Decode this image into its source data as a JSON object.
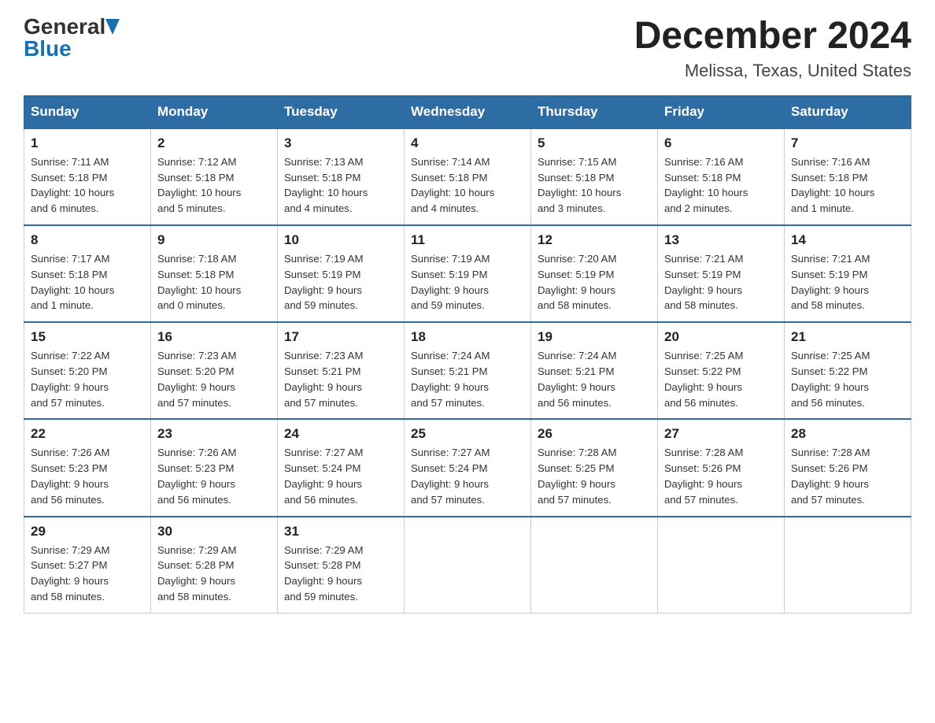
{
  "header": {
    "logo": {
      "general": "General",
      "blue": "Blue"
    },
    "title": "December 2024",
    "subtitle": "Melissa, Texas, United States"
  },
  "days_of_week": [
    "Sunday",
    "Monday",
    "Tuesday",
    "Wednesday",
    "Thursday",
    "Friday",
    "Saturday"
  ],
  "weeks": [
    [
      {
        "day": "1",
        "sunrise": "7:11 AM",
        "sunset": "5:18 PM",
        "daylight": "10 hours and 6 minutes."
      },
      {
        "day": "2",
        "sunrise": "7:12 AM",
        "sunset": "5:18 PM",
        "daylight": "10 hours and 5 minutes."
      },
      {
        "day": "3",
        "sunrise": "7:13 AM",
        "sunset": "5:18 PM",
        "daylight": "10 hours and 4 minutes."
      },
      {
        "day": "4",
        "sunrise": "7:14 AM",
        "sunset": "5:18 PM",
        "daylight": "10 hours and 4 minutes."
      },
      {
        "day": "5",
        "sunrise": "7:15 AM",
        "sunset": "5:18 PM",
        "daylight": "10 hours and 3 minutes."
      },
      {
        "day": "6",
        "sunrise": "7:16 AM",
        "sunset": "5:18 PM",
        "daylight": "10 hours and 2 minutes."
      },
      {
        "day": "7",
        "sunrise": "7:16 AM",
        "sunset": "5:18 PM",
        "daylight": "10 hours and 1 minute."
      }
    ],
    [
      {
        "day": "8",
        "sunrise": "7:17 AM",
        "sunset": "5:18 PM",
        "daylight": "10 hours and 1 minute."
      },
      {
        "day": "9",
        "sunrise": "7:18 AM",
        "sunset": "5:18 PM",
        "daylight": "10 hours and 0 minutes."
      },
      {
        "day": "10",
        "sunrise": "7:19 AM",
        "sunset": "5:19 PM",
        "daylight": "9 hours and 59 minutes."
      },
      {
        "day": "11",
        "sunrise": "7:19 AM",
        "sunset": "5:19 PM",
        "daylight": "9 hours and 59 minutes."
      },
      {
        "day": "12",
        "sunrise": "7:20 AM",
        "sunset": "5:19 PM",
        "daylight": "9 hours and 58 minutes."
      },
      {
        "day": "13",
        "sunrise": "7:21 AM",
        "sunset": "5:19 PM",
        "daylight": "9 hours and 58 minutes."
      },
      {
        "day": "14",
        "sunrise": "7:21 AM",
        "sunset": "5:19 PM",
        "daylight": "9 hours and 58 minutes."
      }
    ],
    [
      {
        "day": "15",
        "sunrise": "7:22 AM",
        "sunset": "5:20 PM",
        "daylight": "9 hours and 57 minutes."
      },
      {
        "day": "16",
        "sunrise": "7:23 AM",
        "sunset": "5:20 PM",
        "daylight": "9 hours and 57 minutes."
      },
      {
        "day": "17",
        "sunrise": "7:23 AM",
        "sunset": "5:21 PM",
        "daylight": "9 hours and 57 minutes."
      },
      {
        "day": "18",
        "sunrise": "7:24 AM",
        "sunset": "5:21 PM",
        "daylight": "9 hours and 57 minutes."
      },
      {
        "day": "19",
        "sunrise": "7:24 AM",
        "sunset": "5:21 PM",
        "daylight": "9 hours and 56 minutes."
      },
      {
        "day": "20",
        "sunrise": "7:25 AM",
        "sunset": "5:22 PM",
        "daylight": "9 hours and 56 minutes."
      },
      {
        "day": "21",
        "sunrise": "7:25 AM",
        "sunset": "5:22 PM",
        "daylight": "9 hours and 56 minutes."
      }
    ],
    [
      {
        "day": "22",
        "sunrise": "7:26 AM",
        "sunset": "5:23 PM",
        "daylight": "9 hours and 56 minutes."
      },
      {
        "day": "23",
        "sunrise": "7:26 AM",
        "sunset": "5:23 PM",
        "daylight": "9 hours and 56 minutes."
      },
      {
        "day": "24",
        "sunrise": "7:27 AM",
        "sunset": "5:24 PM",
        "daylight": "9 hours and 56 minutes."
      },
      {
        "day": "25",
        "sunrise": "7:27 AM",
        "sunset": "5:24 PM",
        "daylight": "9 hours and 57 minutes."
      },
      {
        "day": "26",
        "sunrise": "7:28 AM",
        "sunset": "5:25 PM",
        "daylight": "9 hours and 57 minutes."
      },
      {
        "day": "27",
        "sunrise": "7:28 AM",
        "sunset": "5:26 PM",
        "daylight": "9 hours and 57 minutes."
      },
      {
        "day": "28",
        "sunrise": "7:28 AM",
        "sunset": "5:26 PM",
        "daylight": "9 hours and 57 minutes."
      }
    ],
    [
      {
        "day": "29",
        "sunrise": "7:29 AM",
        "sunset": "5:27 PM",
        "daylight": "9 hours and 58 minutes."
      },
      {
        "day": "30",
        "sunrise": "7:29 AM",
        "sunset": "5:28 PM",
        "daylight": "9 hours and 58 minutes."
      },
      {
        "day": "31",
        "sunrise": "7:29 AM",
        "sunset": "5:28 PM",
        "daylight": "9 hours and 59 minutes."
      },
      null,
      null,
      null,
      null
    ]
  ],
  "labels": {
    "sunrise": "Sunrise:",
    "sunset": "Sunset:",
    "daylight": "Daylight:"
  }
}
